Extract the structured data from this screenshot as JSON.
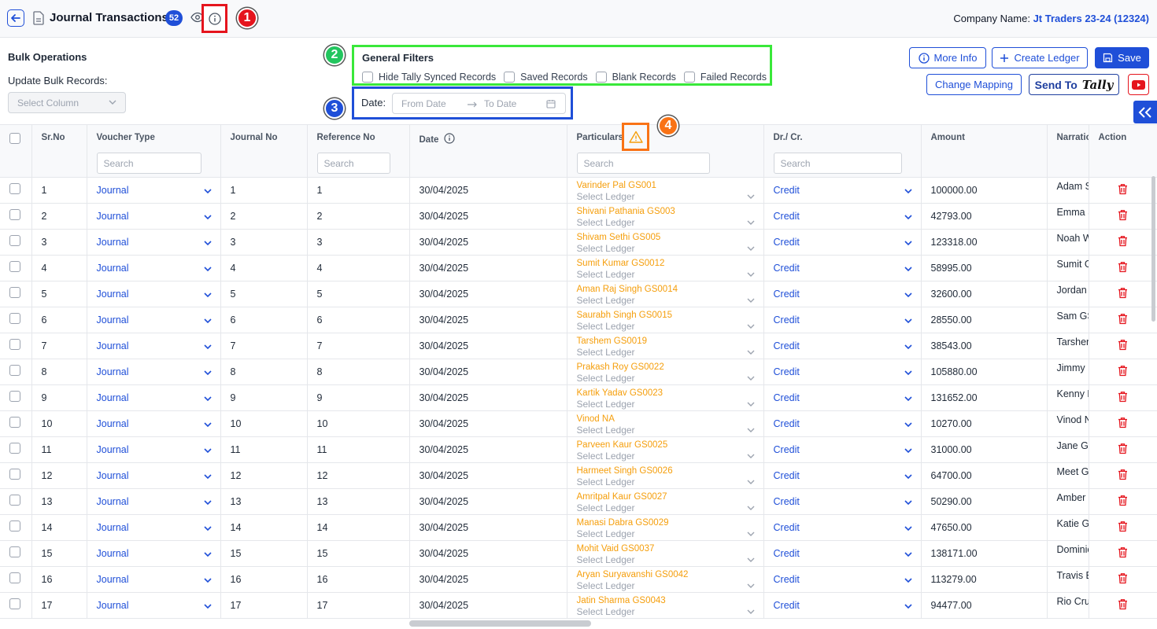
{
  "header": {
    "title": "Journal Transactions",
    "count": "52",
    "company_label": "Company Name:",
    "company_value": "Jt Traders 23-24 (12324)"
  },
  "markers": [
    "1",
    "2",
    "3",
    "4"
  ],
  "bulk": {
    "title": "Bulk Operations",
    "subtitle": "Update Bulk Records:",
    "select_placeholder": "Select Column"
  },
  "filters": {
    "title": "General Filters",
    "options": [
      "Hide Tally Synced Records",
      "Saved Records",
      "Blank Records",
      "Failed Records"
    ]
  },
  "date": {
    "label": "Date:",
    "from_placeholder": "From Date",
    "to_placeholder": "To Date"
  },
  "buttons": {
    "more_info": "More Info",
    "create_ledger": "Create Ledger",
    "save": "Save",
    "change_mapping": "Change Mapping",
    "send_to": "Send To",
    "tally_logo": "Tally"
  },
  "table": {
    "columns": [
      "Sr.No",
      "Voucher Type",
      "Journal No",
      "Reference No",
      "Date",
      "Particulars",
      "Dr./ Cr.",
      "Amount",
      "Narratio",
      "Action"
    ],
    "search_placeholder": "Search",
    "select_ledger": "Select Ledger",
    "rows": [
      {
        "sr": "1",
        "vt": "Journal",
        "jn": "1",
        "ref": "1",
        "date": "30/04/2025",
        "party": "Varinder Pal GS001",
        "drcr": "Credit",
        "amount": "100000.00",
        "narr": "Adam S"
      },
      {
        "sr": "2",
        "vt": "Journal",
        "jn": "2",
        "ref": "2",
        "date": "30/04/2025",
        "party": "Shivani Pathania GS003",
        "drcr": "Credit",
        "amount": "42793.00",
        "narr": "Emma S"
      },
      {
        "sr": "3",
        "vt": "Journal",
        "jn": "3",
        "ref": "3",
        "date": "30/04/2025",
        "party": "Shivam Sethi GS005",
        "drcr": "Credit",
        "amount": "123318.00",
        "narr": "Noah W"
      },
      {
        "sr": "4",
        "vt": "Journal",
        "jn": "4",
        "ref": "4",
        "date": "30/04/2025",
        "party": "Sumit Kumar GS0012",
        "drcr": "Credit",
        "amount": "58995.00",
        "narr": "Sumit G"
      },
      {
        "sr": "5",
        "vt": "Journal",
        "jn": "5",
        "ref": "5",
        "date": "30/04/2025",
        "party": "Aman Raj Singh GS0014",
        "drcr": "Credit",
        "amount": "32600.00",
        "narr": "Jordan"
      },
      {
        "sr": "6",
        "vt": "Journal",
        "jn": "6",
        "ref": "6",
        "date": "30/04/2025",
        "party": "Saurabh Singh GS0015",
        "drcr": "Credit",
        "amount": "28550.00",
        "narr": "Sam GS"
      },
      {
        "sr": "7",
        "vt": "Journal",
        "jn": "7",
        "ref": "7",
        "date": "30/04/2025",
        "party": "Tarshem GS0019",
        "drcr": "Credit",
        "amount": "38543.00",
        "narr": "Tarshen"
      },
      {
        "sr": "8",
        "vt": "Journal",
        "jn": "8",
        "ref": "8",
        "date": "30/04/2025",
        "party": "Prakash Roy GS0022",
        "drcr": "Credit",
        "amount": "105880.00",
        "narr": "Jimmy"
      },
      {
        "sr": "9",
        "vt": "Journal",
        "jn": "9",
        "ref": "9",
        "date": "30/04/2025",
        "party": "Kartik Yadav GS0023",
        "drcr": "Credit",
        "amount": "131652.00",
        "narr": "Kenny N"
      },
      {
        "sr": "10",
        "vt": "Journal",
        "jn": "10",
        "ref": "10",
        "date": "30/04/2025",
        "party": "Vinod NA",
        "drcr": "Credit",
        "amount": "10270.00",
        "narr": "Vinod N"
      },
      {
        "sr": "11",
        "vt": "Journal",
        "jn": "11",
        "ref": "11",
        "date": "30/04/2025",
        "party": "Parveen Kaur GS0025",
        "drcr": "Credit",
        "amount": "31000.00",
        "narr": "Jane GS"
      },
      {
        "sr": "12",
        "vt": "Journal",
        "jn": "12",
        "ref": "12",
        "date": "30/04/2025",
        "party": "Harmeet Singh GS0026",
        "drcr": "Credit",
        "amount": "64700.00",
        "narr": "Meet G"
      },
      {
        "sr": "13",
        "vt": "Journal",
        "jn": "13",
        "ref": "13",
        "date": "30/04/2025",
        "party": "Amritpal Kaur GS0027",
        "drcr": "Credit",
        "amount": "50290.00",
        "narr": "Amber"
      },
      {
        "sr": "14",
        "vt": "Journal",
        "jn": "14",
        "ref": "14",
        "date": "30/04/2025",
        "party": "Manasi Dabra GS0029",
        "drcr": "Credit",
        "amount": "47650.00",
        "narr": "Katie G"
      },
      {
        "sr": "15",
        "vt": "Journal",
        "jn": "15",
        "ref": "15",
        "date": "30/04/2025",
        "party": "Mohit Vaid GS0037",
        "drcr": "Credit",
        "amount": "138171.00",
        "narr": "Dominic"
      },
      {
        "sr": "16",
        "vt": "Journal",
        "jn": "16",
        "ref": "16",
        "date": "30/04/2025",
        "party": "Aryan Suryavanshi GS0042",
        "drcr": "Credit",
        "amount": "113279.00",
        "narr": "Travis E"
      },
      {
        "sr": "17",
        "vt": "Journal",
        "jn": "17",
        "ref": "17",
        "date": "30/04/2025",
        "party": "Jatin Sharma GS0043",
        "drcr": "Credit",
        "amount": "94477.00",
        "narr": "Rio Cru"
      }
    ]
  },
  "colors": {
    "accent": "#1f4fd8",
    "particulars": "#f59e0b",
    "delete": "#e5141d",
    "marker_red": "#e5141d",
    "marker_green": "#22c55e",
    "marker_blue": "#1f4fd8",
    "marker_orange": "#f97316"
  },
  "icons": [
    "back-arrow-icon",
    "document-icon",
    "eye-icon",
    "info-icon",
    "chevron-down-icon",
    "info-circle-icon",
    "plus-icon",
    "save-icon",
    "youtube-icon",
    "double-chevron-left-icon",
    "warning-icon",
    "calendar-icon",
    "arrow-right-icon",
    "trash-icon"
  ]
}
